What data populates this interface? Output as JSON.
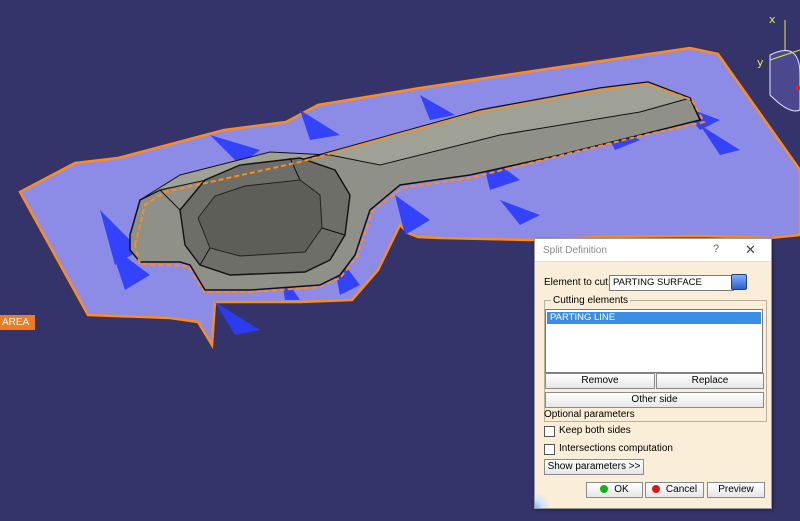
{
  "viewport": {
    "area_tag": "AREA",
    "axes": {
      "x": "x",
      "y": "y"
    },
    "colors": {
      "background": "#34336a",
      "surface": "#8c8ce6",
      "edge": "#ff8c1a",
      "part": "#8e8f86",
      "mesh": "#2a3cff"
    }
  },
  "dialog": {
    "title": "Split Definition",
    "help_label": "?",
    "close_label": "✕",
    "element_to_cut_label": "Element to cut:",
    "element_to_cut_value": "PARTING SURFACE",
    "cutting_elements_label": "Cutting elements",
    "cutting_elements": [
      "PARTING  LINE"
    ],
    "remove_label": "Remove",
    "replace_label": "Replace",
    "other_side_label": "Other side",
    "optional_parameters_label": "Optional parameters",
    "keep_both_sides_label": "Keep both sides",
    "keep_both_sides_checked": false,
    "intersections_label": "Intersections computation",
    "intersections_checked": false,
    "show_parameters_label": "Show parameters >>",
    "ok_label": "OK",
    "cancel_label": "Cancel",
    "preview_label": "Preview"
  }
}
